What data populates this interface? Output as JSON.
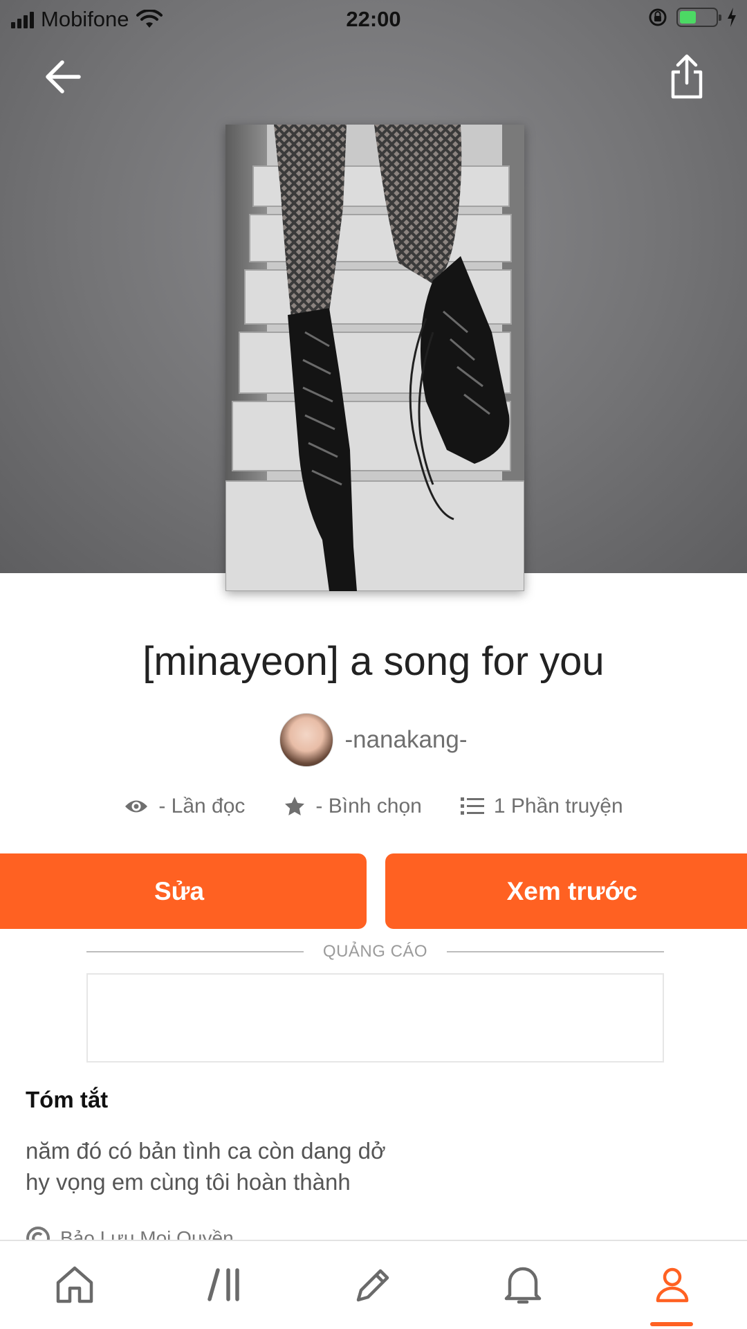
{
  "status_bar": {
    "carrier": "Mobifone",
    "time": "22:00"
  },
  "story": {
    "title": "[minayeon] a song for you",
    "author": "-nanakang-",
    "stats": {
      "reads": "- Lần đọc",
      "votes": "- Bình chọn",
      "parts": "1 Phần truyện"
    }
  },
  "actions": {
    "edit_label": "Sửa",
    "preview_label": "Xem trước"
  },
  "ad": {
    "label": "QUẢNG CÁO"
  },
  "summary": {
    "heading": "Tóm tắt",
    "line1": "năm đó có bản tình ca còn dang dở",
    "line2": "hy vọng em cùng tôi hoàn thành",
    "copyright": "Bảo Lưu Mọi Quyền"
  },
  "nav": {
    "items": [
      "home-icon",
      "library-icon",
      "write-icon",
      "notifications-icon",
      "profile-icon"
    ],
    "active": "profile-icon"
  },
  "colors": {
    "accent": "#ff6122",
    "hero_bg": "#767678"
  }
}
